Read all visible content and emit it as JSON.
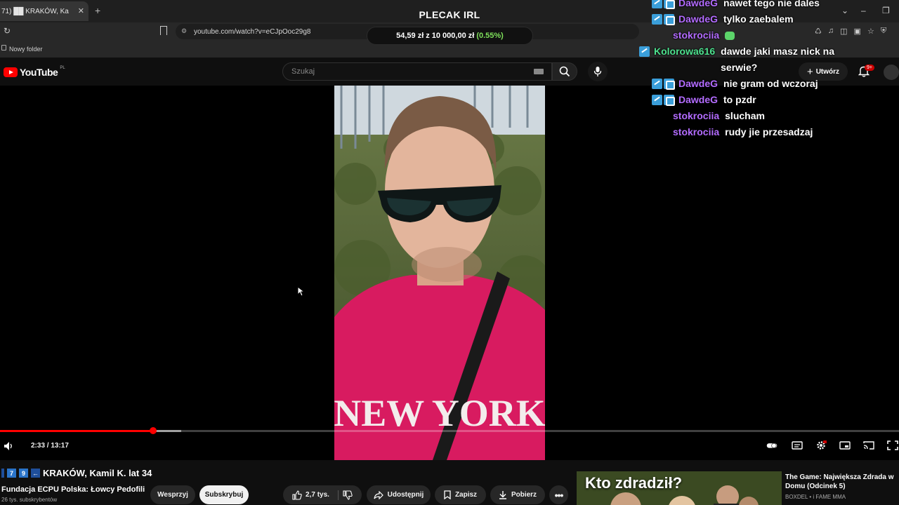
{
  "browser": {
    "tab_title": "71) ██ KRAKÓW, Ka",
    "tab_close": "✕",
    "new_tab": "+",
    "url": "youtube.com/watch?v=eCJpOoc29g8",
    "bookmark_folder": "Nowy folder"
  },
  "overlay": {
    "title": "PLECAK IRL",
    "amount": "54,59 zł",
    "of": "z",
    "goal": "10 000,00 zł",
    "percent": "(0.55%)"
  },
  "youtube": {
    "logo_text": "YouTube",
    "region": "PL",
    "search_placeholder": "Szukaj",
    "create_label": "Utwórz",
    "notifications_badge": "9+"
  },
  "chat": [
    {
      "nick": "DawdeG",
      "text": "nawet tego nie dales",
      "color": "#b36cff",
      "badges": 2
    },
    {
      "nick": "DawdeG",
      "text": "tylko zaebalem",
      "color": "#b36cff",
      "badges": 2
    },
    {
      "nick": "stokrociia",
      "text": "",
      "color": "#b36cff",
      "badges": 0
    },
    {
      "nick": "Kolorowa616",
      "text": "dawde jaki masz nick na",
      "text2": "serwie?",
      "color": "#4ee28f",
      "badges": 1
    },
    {
      "nick": "DawdeG",
      "text": "nie gram od wczoraj",
      "color": "#b36cff",
      "badges": 2
    },
    {
      "nick": "DawdeG",
      "text": "to pzdr",
      "color": "#b36cff",
      "badges": 2
    },
    {
      "nick": "stokrociia",
      "text": "slucham",
      "color": "#b36cff",
      "badges": 0
    },
    {
      "nick": "stokrociia",
      "text": "rudy jie przesadzaj",
      "color": "#b36cff",
      "badges": 0
    }
  ],
  "player": {
    "time": "2:33 / 13:17",
    "progress_fraction": 0.17
  },
  "video": {
    "number_badges": [
      "7",
      "9"
    ],
    "title": "KRAKÓW, Kamil K. lat 34",
    "channel": "Fundacja ECPU Polska: Łowcy Pedofili",
    "subscribers": "26 tys. subskrybentów",
    "support_label": "Wesprzyj",
    "subscribe_label": "Subskrybuj",
    "likes": "2,7 tys.",
    "share_label": "Udostępnij",
    "save_label": "Zapisz",
    "download_label": "Pobierz",
    "shirt_text": "NEW YORK"
  },
  "recommended": {
    "thumb_text": "Kto zdradził?",
    "title": "The Game: Największa Zdrada w Domu (Odcinek 5)",
    "channel": "BOXDEL • i FAME MMA"
  }
}
